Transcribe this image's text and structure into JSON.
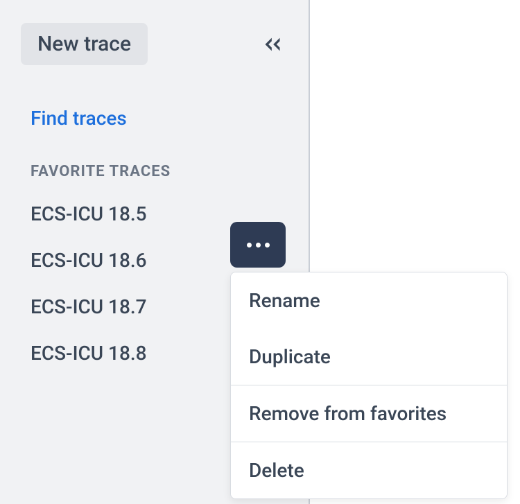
{
  "sidebar": {
    "new_trace_label": "New trace",
    "find_traces_label": "Find traces",
    "section_header": "Favorite Traces",
    "traces": [
      {
        "name": "ECS-ICU 18.5"
      },
      {
        "name": "ECS-ICU 18.6"
      },
      {
        "name": "ECS-ICU 18.7"
      },
      {
        "name": "ECS-ICU 18.8"
      }
    ]
  },
  "context_menu": {
    "rename": "Rename",
    "duplicate": "Duplicate",
    "remove_favorite": "Remove from favorites",
    "delete": "Delete"
  }
}
